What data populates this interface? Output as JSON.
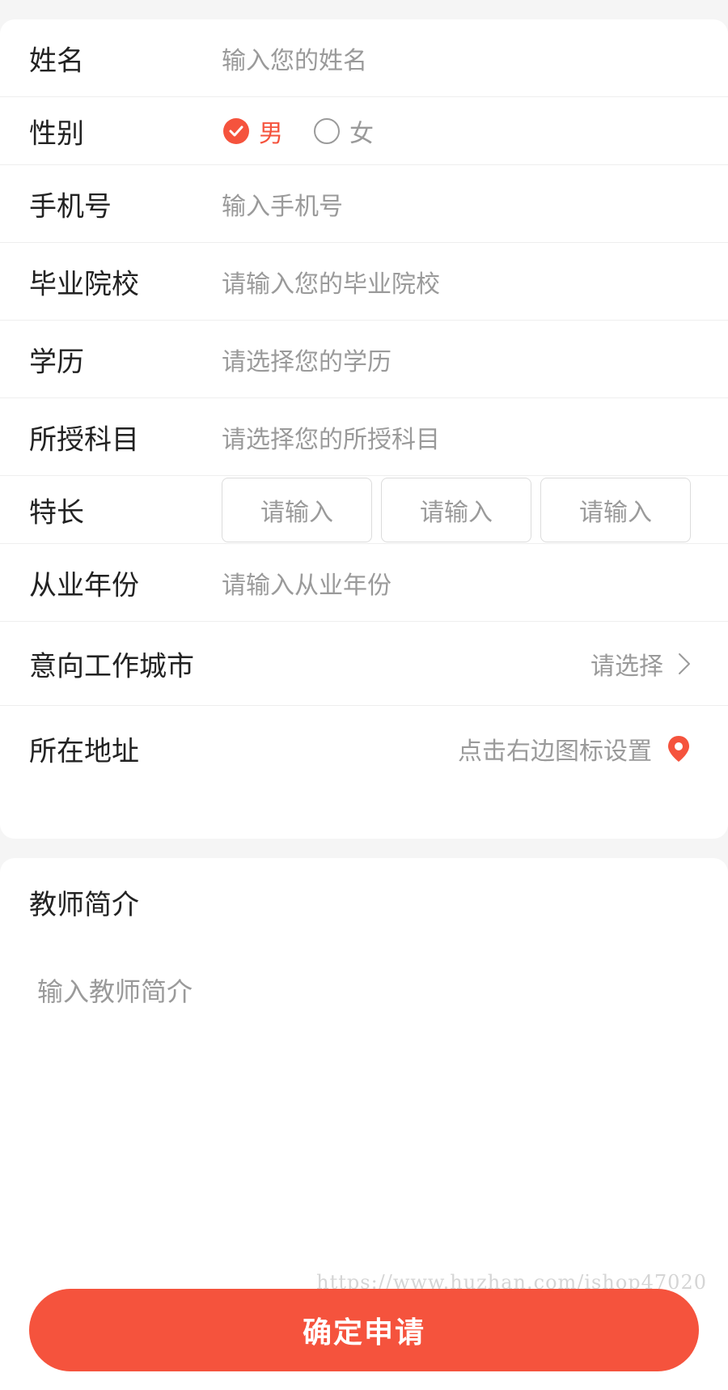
{
  "form": {
    "name": {
      "label": "姓名",
      "placeholder": "输入您的姓名"
    },
    "gender": {
      "label": "性别",
      "options": [
        "男",
        "女"
      ],
      "selected": "男"
    },
    "phone": {
      "label": "手机号",
      "placeholder": "输入手机号"
    },
    "school": {
      "label": "毕业院校",
      "placeholder": "请输入您的毕业院校"
    },
    "education": {
      "label": "学历",
      "placeholder": "请选择您的学历"
    },
    "subject": {
      "label": "所授科目",
      "placeholder": "请选择您的所授科目"
    },
    "specialty": {
      "label": "特长",
      "placeholders": [
        "请输入",
        "请输入",
        "请输入"
      ]
    },
    "years": {
      "label": "从业年份",
      "placeholder": "请输入从业年份"
    },
    "city": {
      "label": "意向工作城市",
      "placeholder": "请选择"
    },
    "address": {
      "label": "所在地址",
      "placeholder": "点击右边图标设置"
    }
  },
  "intro": {
    "label": "教师简介",
    "placeholder": "输入教师简介"
  },
  "watermark": "https://www.huzhan.com/ishop47020",
  "submit_label": "确定申请",
  "colors": {
    "accent": "#f5533d",
    "placeholder": "#9a9a9a",
    "text": "#222222"
  },
  "icons": {
    "checked": "check-circle-icon",
    "unchecked": "radio-empty-icon",
    "city": "chevron-right-icon",
    "address": "location-pin-icon"
  }
}
